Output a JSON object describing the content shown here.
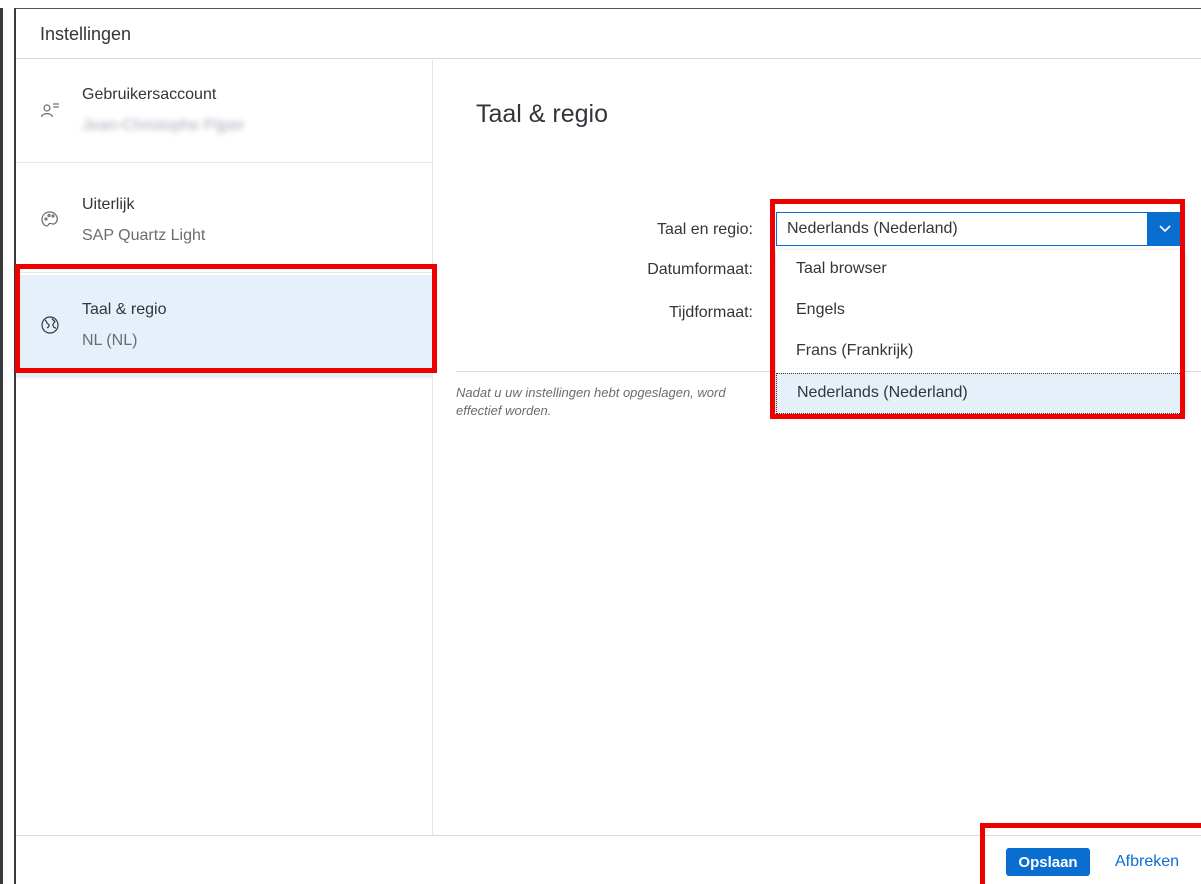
{
  "dialog": {
    "title": "Instellingen"
  },
  "sidebar": {
    "items": [
      {
        "title": "Gebruikersaccount",
        "subtitle": "Jean-Christophe Pijper",
        "icon": "user-account-icon"
      },
      {
        "title": "Uiterlijk",
        "subtitle": "SAP Quartz Light",
        "icon": "palette-icon"
      },
      {
        "title": "Taal & regio",
        "subtitle": "NL (NL)",
        "icon": "globe-icon",
        "selected": true
      }
    ]
  },
  "content": {
    "title": "Taal & regio",
    "labels": {
      "language_region": "Taal en regio:",
      "date_format": "Datumformaat:",
      "time_format": "Tijdformaat:"
    },
    "select": {
      "value": "Nederlands (Nederland)",
      "options": [
        "Taal browser",
        "Engels",
        "Frans (Frankrijk)",
        "Nederlands (Nederland)"
      ],
      "selected_index": 3
    },
    "note": "Nadat u uw instellingen hebt opgeslagen, word effectief worden."
  },
  "footer": {
    "save_label": "Opslaan",
    "cancel_label": "Afbreken"
  },
  "colors": {
    "accent": "#0a6ed1",
    "selected_bg": "#e5f0fa",
    "highlight": "#ee0000"
  }
}
